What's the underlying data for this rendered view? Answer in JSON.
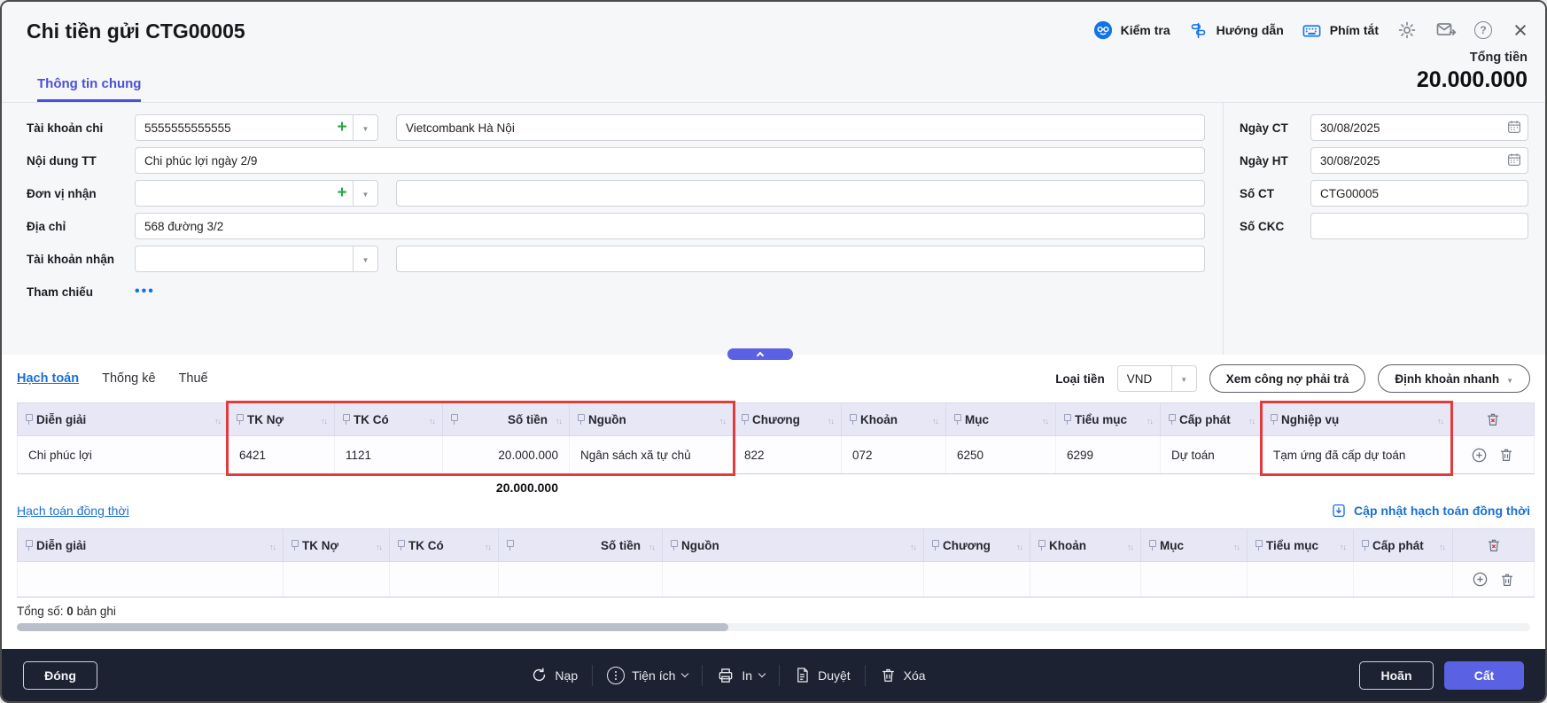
{
  "header": {
    "title": "Chi tiền gửi CTG00005",
    "check_label": "Kiểm tra",
    "guide_label": "Hướng dẫn",
    "shortcut_label": "Phím tắt",
    "total_label": "Tổng tiền",
    "total_value": "20.000.000",
    "tab": "Thông tin chung"
  },
  "form": {
    "tai_khoan_chi": {
      "label": "Tài khoản chi",
      "value": "5555555555555",
      "bank_name": "Vietcombank Hà Nội"
    },
    "noi_dung_tt": {
      "label": "Nội dung TT",
      "value": "Chi phúc lợi ngày 2/9"
    },
    "don_vi_nhan": {
      "label": "Đơn vị nhận",
      "value": "",
      "name": ""
    },
    "dia_chi": {
      "label": "Địa chỉ",
      "value": "568 đường 3/2"
    },
    "tai_khoan_nhan": {
      "label": "Tài khoản nhận",
      "value": "",
      "name": ""
    },
    "tham_chieu": {
      "label": "Tham chiếu",
      "more": "•••"
    },
    "ngay_ct": {
      "label": "Ngày CT",
      "value": "30/08/2025"
    },
    "ngay_ht": {
      "label": "Ngày HT",
      "value": "30/08/2025"
    },
    "so_ct": {
      "label": "Số CT",
      "value": "CTG00005"
    },
    "so_ckc": {
      "label": "Số CKC",
      "value": ""
    }
  },
  "detail": {
    "tabs": [
      "Hạch toán",
      "Thống kê",
      "Thuế"
    ],
    "currency_label": "Loại tiền",
    "currency_value": "VND",
    "btn_debt": "Xem công nợ phải trả",
    "btn_quick": "Định khoản nhanh",
    "table": {
      "columns": [
        "Diễn giải",
        "TK Nợ",
        "TK Có",
        "Số tiền",
        "Nguồn",
        "Chương",
        "Khoản",
        "Mục",
        "Tiểu mục",
        "Cấp phát",
        "Nghiệp vụ"
      ],
      "rows": [
        [
          "Chi phúc lợi",
          "6421",
          "1121",
          "20.000.000",
          "Ngân sách xã tự chủ",
          "822",
          "072",
          "6250",
          "6299",
          "Dự toán",
          "Tạm ứng đã cấp dự toán"
        ]
      ],
      "total": "20.000.000"
    },
    "simultaneous": {
      "link": "Hạch toán đồng thời",
      "update_link": "Cập nhật hạch toán đồng thời",
      "columns": [
        "Diễn giải",
        "TK Nợ",
        "TK Có",
        "Số tiền",
        "Nguồn",
        "Chương",
        "Khoản",
        "Mục",
        "Tiểu mục",
        "Cấp phát"
      ]
    },
    "summary": {
      "prefix": "Tổng số:",
      "count": "0",
      "suffix": "bản ghi"
    }
  },
  "footer": {
    "close": "Đóng",
    "reload": "Nạp",
    "utilities": "Tiện ích",
    "print": "In",
    "approve": "Duyệt",
    "delete": "Xóa",
    "postpone": "Hoãn",
    "save": "Cất"
  },
  "colors": {
    "accent_indigo": "#5a61e2",
    "link_blue": "#1a6fd4",
    "brand_blue": "#1273eb",
    "highlight_red": "#e23b3c",
    "footer_bg": "#1d2232"
  }
}
